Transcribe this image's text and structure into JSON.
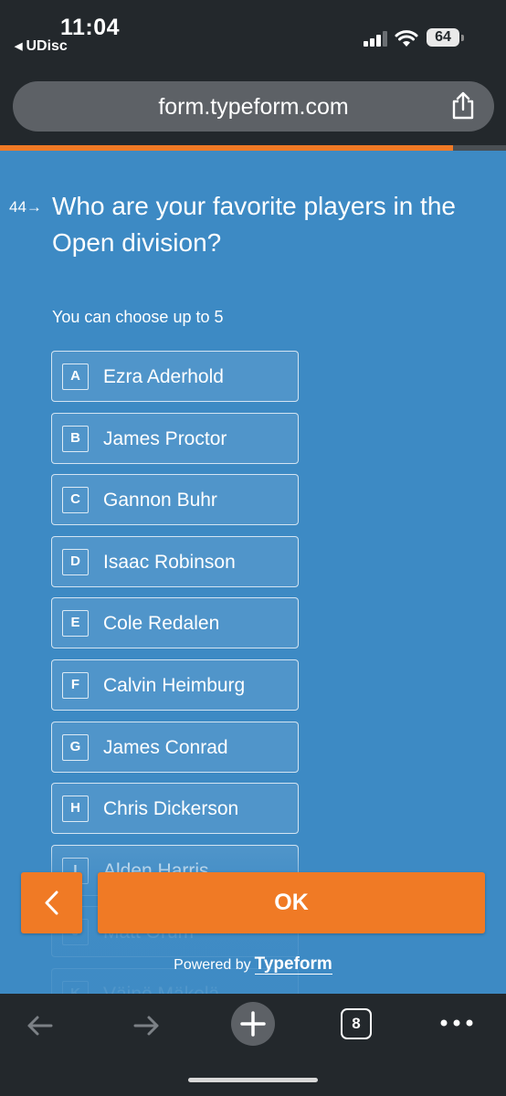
{
  "status_bar": {
    "time": "11:04",
    "back_app": "UDisc",
    "battery": "64"
  },
  "browser": {
    "url": "form.typeform.com",
    "progress_fraction": 0.895
  },
  "question": {
    "number": "44",
    "text": "Who are your favorite players in the Open division?",
    "hint": "You can choose up to 5"
  },
  "choices": [
    {
      "key": "A",
      "label": "Ezra Aderhold"
    },
    {
      "key": "B",
      "label": "James Proctor"
    },
    {
      "key": "C",
      "label": "Gannon Buhr"
    },
    {
      "key": "D",
      "label": "Isaac Robinson"
    },
    {
      "key": "E",
      "label": "Cole Redalen"
    },
    {
      "key": "F",
      "label": "Calvin Heimburg"
    },
    {
      "key": "G",
      "label": "James Conrad"
    },
    {
      "key": "H",
      "label": "Chris Dickerson"
    },
    {
      "key": "I",
      "label": "Alden Harris"
    },
    {
      "key": "J",
      "label": "Matt Orum"
    },
    {
      "key": "K",
      "label": "Väinö Mäkelä"
    }
  ],
  "actions": {
    "ok_label": "OK",
    "powered_by": "Powered by",
    "brand": "Typeform"
  },
  "toolbar": {
    "tab_count": "8"
  },
  "colors": {
    "form_background": "#3d8ac4",
    "accent": "#f07a25",
    "chrome": "#23282c"
  }
}
